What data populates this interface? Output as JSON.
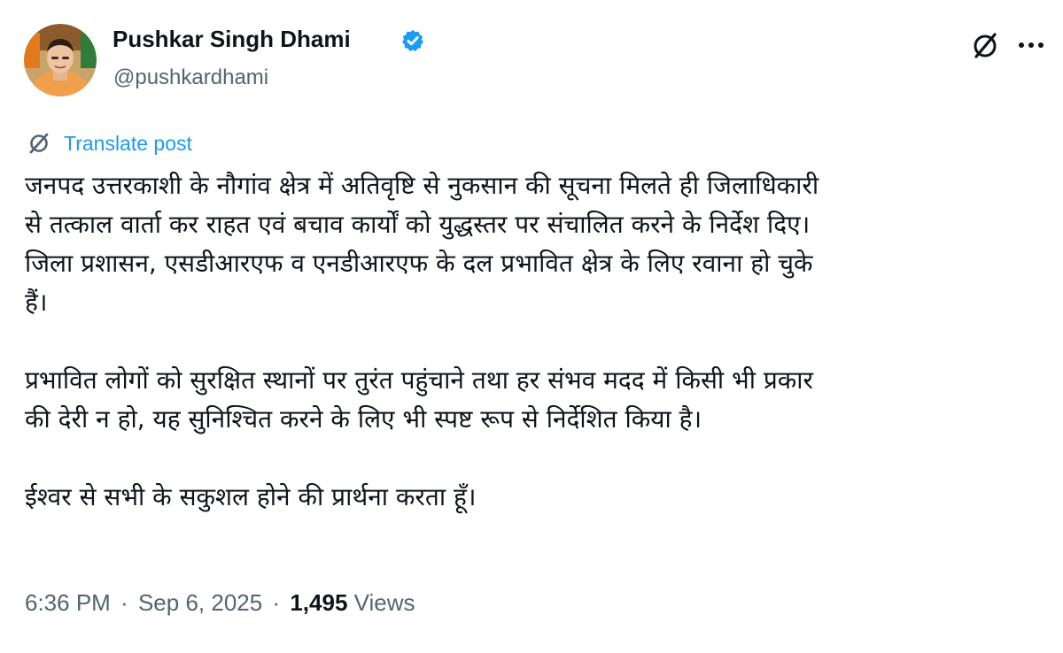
{
  "author": {
    "name": "Pushkar Singh Dhami",
    "handle": "@pushkardhami",
    "verified_color": "#1d9bf0"
  },
  "header_actions": {
    "grok_icon": "grok-icon",
    "more_icon": "more-icon"
  },
  "translate": {
    "icon": "translate-icon",
    "label": "Translate post"
  },
  "post": {
    "paragraph_1_line_1": "जनपद उत्तरकाशी के नौगांव क्षेत्र में अतिवृष्टि से नुकसान की सूचना मिलते ही जिलाधिकारी",
    "paragraph_1_line_2": "से तत्काल वार्ता कर राहत एवं बचाव कार्यों को युद्धस्तर पर संचालित करने के निर्देश दिए।",
    "paragraph_1_line_3": "जिला प्रशासन, एसडीआरएफ व एनडीआरएफ के दल प्रभावित क्षेत्र के लिए रवाना हो चुके",
    "paragraph_1_line_4": "हैं।",
    "paragraph_2_line_1": "प्रभावित लोगों को सुरक्षित स्थानों पर तुरंत पहुंचाने तथा हर संभव मदद में किसी भी प्रकार",
    "paragraph_2_line_2": "की देरी न हो, यह सुनिश्चित करने के लिए भी स्पष्ट रूप से निर्देशित किया है।",
    "paragraph_3_line_1": "ईश्वर से सभी के सकुशल होने की प्रार्थना करता हूँ।"
  },
  "meta": {
    "time": "6:36 PM",
    "separator": "·",
    "date": "Sep 6, 2025",
    "views_count": "1,495",
    "views_label": "Views"
  }
}
